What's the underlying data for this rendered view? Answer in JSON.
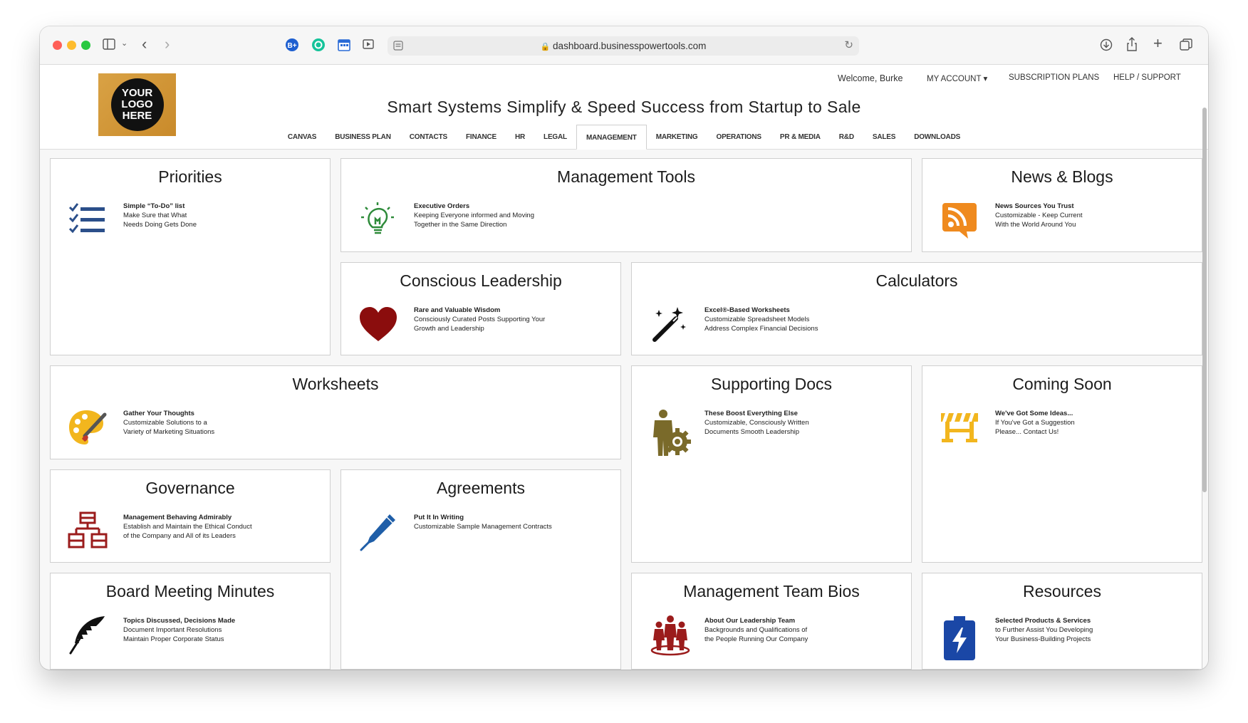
{
  "browser": {
    "url": "dashboard.businesspowertools.com"
  },
  "header": {
    "logo_text": [
      "YOUR",
      "LOGO",
      "HERE"
    ],
    "welcome": "Welcome, Burke",
    "my_account": "MY ACCOUNT ▾",
    "subscription_plans": "SUBSCRIPTION PLANS",
    "help_support": "HELP / SUPPORT",
    "tagline": "Smart Systems Simplify & Speed Success from Startup to Sale"
  },
  "nav": {
    "tabs": [
      "CANVAS",
      "BUSINESS PLAN",
      "CONTACTS",
      "FINANCE",
      "HR",
      "LEGAL",
      "MANAGEMENT",
      "MARKETING",
      "OPERATIONS",
      "PR & MEDIA",
      "R&D",
      "SALES",
      "DOWNLOADS"
    ],
    "active": "MANAGEMENT"
  },
  "cards": {
    "priorities": {
      "title": "Priorities",
      "head": "Simple “To-Do” list",
      "l1": "Make Sure that What",
      "l2": "Needs Doing Gets Done",
      "icon": "checklist-icon"
    },
    "management_tools": {
      "title": "Management Tools",
      "head": "Executive Orders",
      "l1": "Keeping Everyone informed and Moving",
      "l2": "Together in the Same Direction",
      "icon": "lightbulb-icon"
    },
    "news_blogs": {
      "title": "News & Blogs",
      "head": "News Sources You Trust",
      "l1": "Customizable - Keep Current",
      "l2": "With the World Around You",
      "icon": "rss-icon"
    },
    "conscious_leadership": {
      "title": "Conscious Leadership",
      "head": "Rare and Valuable Wisdom",
      "l1": "Consciously Curated Posts Supporting Your",
      "l2": "Growth and Leadership",
      "icon": "heart-icon"
    },
    "calculators": {
      "title": "Calculators",
      "head": "Excel®-Based Worksheets",
      "l1": "Customizable Spreadsheet Models",
      "l2": "Address Complex Financial Decisions",
      "icon": "magic-wand-icon"
    },
    "worksheets": {
      "title": "Worksheets",
      "head": "Gather Your Thoughts",
      "l1": "Customizable Solutions to a",
      "l2": "Variety of Marketing Situations",
      "icon": "palette-icon"
    },
    "supporting_docs": {
      "title": "Supporting Docs",
      "head": "These Boost Everything Else",
      "l1": "Customizable, Consciously Written",
      "l2": "Documents Smooth Leadership",
      "icon": "person-gear-icon"
    },
    "coming_soon": {
      "title": "Coming Soon",
      "head": "We've Got Some Ideas...",
      "l1": "If You've Got a Suggestion",
      "l2": "Please... Contact Us!",
      "icon": "barrier-icon"
    },
    "governance": {
      "title": "Governance",
      "head": "Management Behaving Admirably",
      "l1": "Establish and Maintain the Ethical Conduct",
      "l2": "of the Company and All of its Leaders",
      "icon": "org-chart-icon"
    },
    "agreements": {
      "title": "Agreements",
      "head": "Put It In Writing",
      "l1": "Customizable Sample Management Contracts",
      "l2": "",
      "icon": "pen-icon"
    },
    "board_minutes": {
      "title": "Board Meeting Minutes",
      "head": "Topics Discussed, Decisions Made",
      "l1": "Document Important Resolutions",
      "l2": "Maintain Proper Corporate Status",
      "icon": "quill-icon"
    },
    "team_bios": {
      "title": "Management Team Bios",
      "head": "About Our Leadership Team",
      "l1": "Backgrounds and Qualifications of",
      "l2": "the People Running Our Company",
      "icon": "team-icon"
    },
    "resources": {
      "title": "Resources",
      "head": "Selected Products & Services",
      "l1": "to Further Assist You Developing",
      "l2": "Your Business-Building Projects",
      "icon": "battery-bolt-icon"
    }
  },
  "colors": {
    "checklist": "#2b4f8a",
    "lightbulb": "#2e8b3a",
    "rss": "#ef8a1e",
    "heart": "#8b0d0d",
    "palette": "#f2b61e",
    "gear": "#7a6a2a",
    "barrier": "#f2b61e",
    "org_chart": "#9b1c1c",
    "pen": "#1f5ea8",
    "team": "#9b1c1c",
    "battery": "#1a47a6"
  }
}
